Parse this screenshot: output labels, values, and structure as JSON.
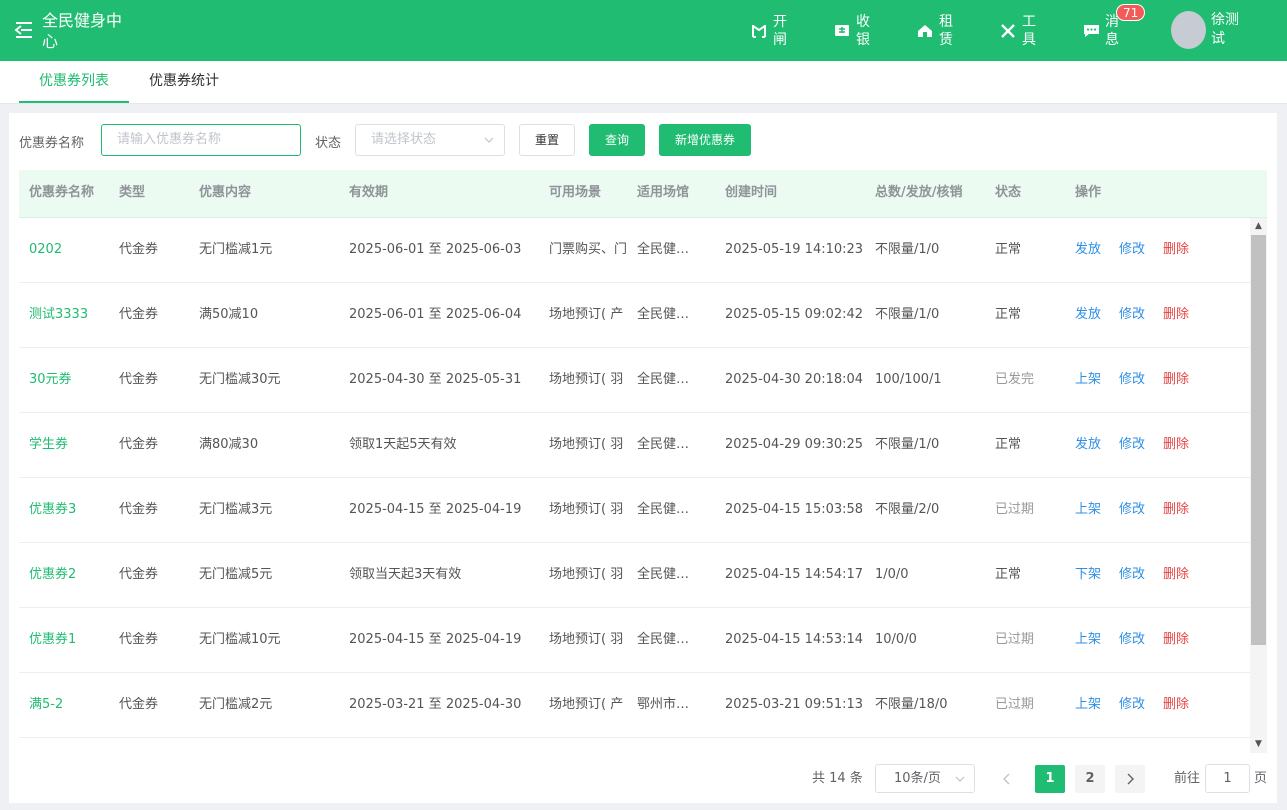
{
  "header": {
    "title": "全民健身中心",
    "nav": [
      {
        "label": "开闸",
        "icon": "gate-icon"
      },
      {
        "label": "收银",
        "icon": "cashier-icon"
      },
      {
        "label": "租赁",
        "icon": "home-icon"
      },
      {
        "label": "工具",
        "icon": "tools-icon"
      },
      {
        "label": "消息",
        "icon": "message-icon"
      }
    ],
    "message_badge": "71",
    "user_name": "徐测试"
  },
  "tabs": [
    {
      "label": "优惠券列表",
      "active": true
    },
    {
      "label": "优惠券统计",
      "active": false
    }
  ],
  "filters": {
    "name_label": "优惠券名称",
    "name_placeholder": "请输入优惠券名称",
    "status_label": "状态",
    "status_placeholder": "请选择状态",
    "reset_label": "重置",
    "query_label": "查询",
    "add_label": "新增优惠券"
  },
  "table": {
    "columns": [
      "优惠券名称",
      "类型",
      "优惠内容",
      "有效期",
      "可用场景",
      "适用场馆",
      "创建时间",
      "总数/发放/核销",
      "状态",
      "操作"
    ],
    "rows": [
      {
        "name": "0202",
        "type": "代金券",
        "content": "无门槛减1元",
        "validity": "2025-06-01 至 2025-06-03",
        "scene": "门票购买、门",
        "venue": "全民健身中心",
        "created": "2025-05-19 14:10:23",
        "counts": "不限量/1/0",
        "status": "正常",
        "status_muted": false,
        "actions": [
          "发放",
          "修改",
          "删除"
        ]
      },
      {
        "name": "测试3333",
        "type": "代金券",
        "content": "满50减10",
        "validity": "2025-06-01 至 2025-06-04",
        "scene": "场地预订( 产",
        "venue": "全民健身中心",
        "created": "2025-05-15 09:02:42",
        "counts": "不限量/1/0",
        "status": "正常",
        "status_muted": false,
        "actions": [
          "发放",
          "修改",
          "删除"
        ]
      },
      {
        "name": "30元券",
        "type": "代金券",
        "content": "无门槛减30元",
        "validity": "2025-04-30 至 2025-05-31",
        "scene": "场地预订( 羽",
        "venue": "全民健身中心",
        "created": "2025-04-30 20:18:04",
        "counts": "100/100/1",
        "status": "已发完",
        "status_muted": true,
        "actions": [
          "上架",
          "修改",
          "删除"
        ]
      },
      {
        "name": "学生券",
        "type": "代金券",
        "content": "满80减30",
        "validity": "领取1天起5天有效",
        "scene": "场地预订( 羽",
        "venue": "全民健身中心",
        "created": "2025-04-29 09:30:25",
        "counts": "不限量/1/0",
        "status": "正常",
        "status_muted": false,
        "actions": [
          "发放",
          "修改",
          "删除"
        ]
      },
      {
        "name": "优惠券3",
        "type": "代金券",
        "content": "无门槛减3元",
        "validity": "2025-04-15 至 2025-04-19",
        "scene": "场地预订( 羽",
        "venue": "全民健身中心",
        "created": "2025-04-15 15:03:58",
        "counts": "不限量/2/0",
        "status": "已过期",
        "status_muted": true,
        "actions": [
          "上架",
          "修改",
          "删除"
        ]
      },
      {
        "name": "优惠券2",
        "type": "代金券",
        "content": "无门槛减5元",
        "validity": "领取当天起3天有效",
        "scene": "场地预订( 羽",
        "venue": "全民健身中心",
        "created": "2025-04-15 14:54:17",
        "counts": "1/0/0",
        "status": "正常",
        "status_muted": false,
        "actions": [
          "下架",
          "修改",
          "删除"
        ]
      },
      {
        "name": "优惠券1",
        "type": "代金券",
        "content": "无门槛减10元",
        "validity": "2025-04-15 至 2025-04-19",
        "scene": "场地预订( 羽",
        "venue": "全民健身中心",
        "created": "2025-04-15 14:53:14",
        "counts": "10/0/0",
        "status": "已过期",
        "status_muted": true,
        "actions": [
          "上架",
          "修改",
          "删除"
        ]
      },
      {
        "name": "满5-2",
        "type": "代金券",
        "content": "无门槛减2元",
        "validity": "2025-03-21 至 2025-04-30",
        "scene": "场地预订( 产",
        "venue": "鄂州市体育中心",
        "created": "2025-03-21 09:51:13",
        "counts": "不限量/18/0",
        "status": "已过期",
        "status_muted": true,
        "actions": [
          "上架",
          "修改",
          "删除"
        ]
      }
    ]
  },
  "pagination": {
    "total_text": "共 14 条",
    "page_size": "10条/页",
    "pages": [
      "1",
      "2"
    ],
    "current_page": "1",
    "goto_label": "前往",
    "goto_value": "1",
    "goto_suffix": "页"
  },
  "colors": {
    "primary": "#1fbc71",
    "link": "#2f8fe6",
    "danger": "#e94343"
  }
}
